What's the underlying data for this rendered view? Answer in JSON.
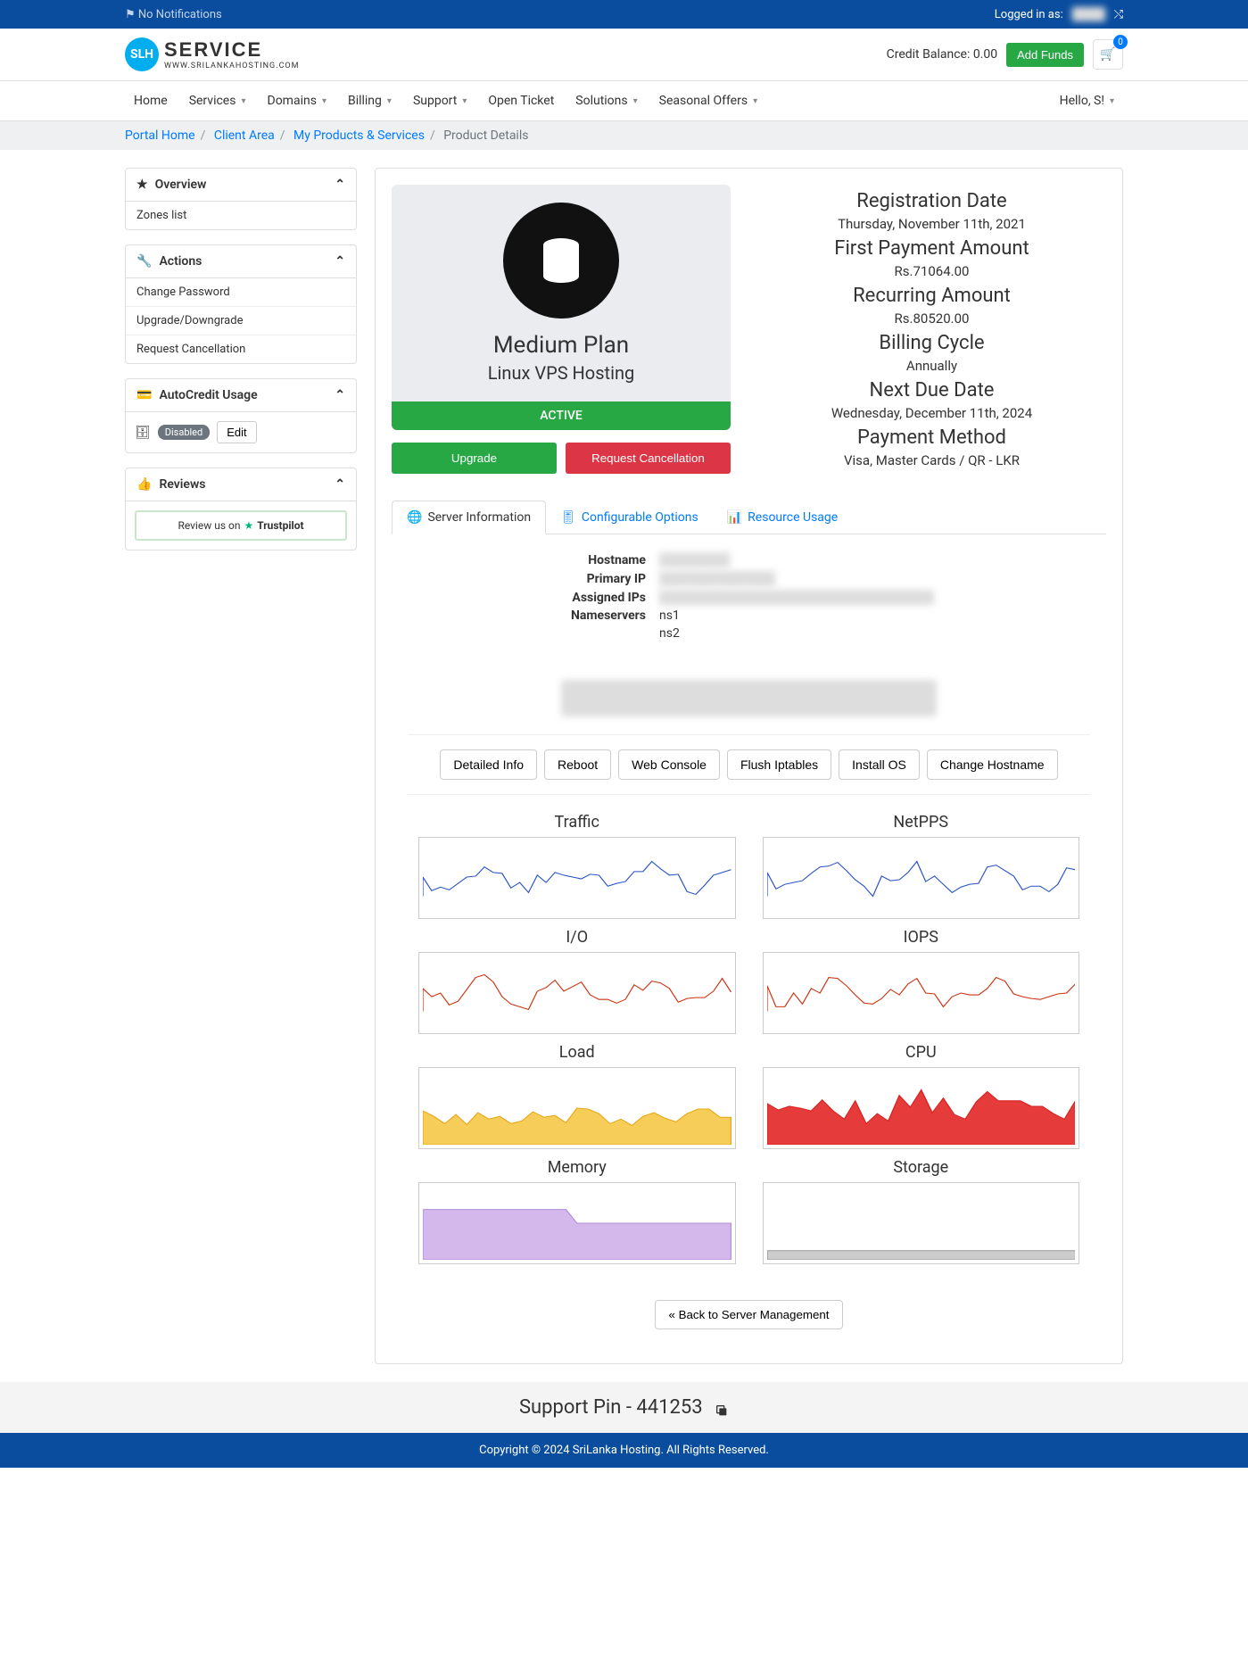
{
  "topbar": {
    "no_notifications": "No Notifications",
    "logged_in_as_label": "Logged in as:",
    "logged_in_user": "████"
  },
  "header": {
    "logo_top": "SERVICE",
    "logo_bottom": "WWW.SRILANKAHOSTING.COM",
    "credit_label": "Credit Balance: 0.00",
    "add_funds": "Add Funds",
    "cart_count": "0"
  },
  "nav": {
    "items": [
      "Home",
      "Services",
      "Domains",
      "Billing",
      "Support",
      "Open Ticket",
      "Solutions",
      "Seasonal Offers"
    ],
    "dropdown": [
      false,
      true,
      true,
      true,
      true,
      false,
      true,
      true
    ],
    "hello_label": "Hello, S!"
  },
  "breadcrumb": {
    "portal": "Portal Home",
    "client": "Client Area",
    "products": "My Products & Services",
    "current": "Product Details"
  },
  "sidebar": {
    "overview": {
      "title": "Overview",
      "items": [
        "Zones list"
      ]
    },
    "actions": {
      "title": "Actions",
      "items": [
        "Change Password",
        "Upgrade/Downgrade",
        "Request Cancellation"
      ]
    },
    "autocredit": {
      "title": "AutoCredit Usage",
      "disabled": "Disabled",
      "edit": "Edit"
    },
    "reviews": {
      "title": "Reviews",
      "trustpilot_prefix": "Review us on ",
      "trustpilot_brand": "Trustpilot"
    }
  },
  "product": {
    "plan": "Medium Plan",
    "sub": "Linux VPS Hosting",
    "status": "ACTIVE",
    "upgrade": "Upgrade",
    "cancel": "Request Cancellation"
  },
  "details": {
    "reg_h": "Registration Date",
    "reg_v": "Thursday, November 11th, 2021",
    "first_h": "First Payment Amount",
    "first_v": "Rs.71064.00",
    "recur_h": "Recurring Amount",
    "recur_v": "Rs.80520.00",
    "cycle_h": "Billing Cycle",
    "cycle_v": "Annually",
    "due_h": "Next Due Date",
    "due_v": "Wednesday, December 11th, 2024",
    "pay_h": "Payment Method",
    "pay_v": "Visa, Master Cards / QR - LKR"
  },
  "tabs": {
    "server": "Server Information",
    "config": "Configurable Options",
    "resource": "Resource Usage"
  },
  "server_info": {
    "hostname_l": "Hostname",
    "hostname_v": "████████",
    "ip_l": "Primary IP",
    "ip_v": "███.███.███.███",
    "assigned_l": "Assigned IPs",
    "assigned_v": "███████████████████████████████",
    "ns_l": "Nameservers",
    "ns1": "ns1",
    "ns2": "ns2",
    "domain_big": "██████████.com"
  },
  "action_buttons": [
    "Detailed Info",
    "Reboot",
    "Web Console",
    "Flush Iptables",
    "Install OS",
    "Change Hostname"
  ],
  "charts": [
    "Traffic",
    "NetPPS",
    "I/O",
    "IOPS",
    "Load",
    "CPU",
    "Memory",
    "Storage"
  ],
  "back_link": "« Back to Server Management",
  "support_pin": "Support Pin - 441253",
  "footer": "Copyright © 2024 SriLanka Hosting. All Rights Reserved."
}
